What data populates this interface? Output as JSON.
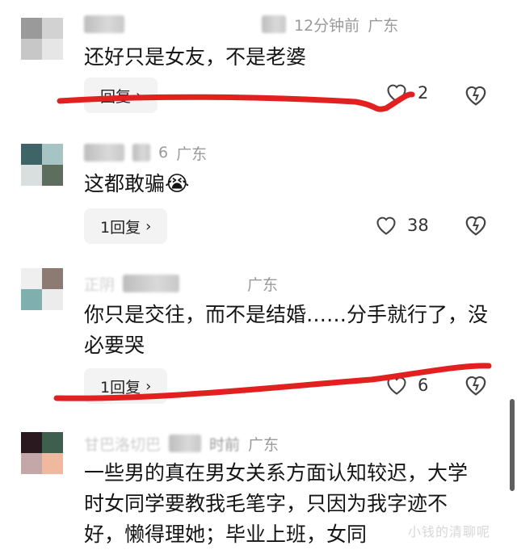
{
  "comments": [
    {
      "time": "12分钟前",
      "region": "广东",
      "text": "还好只是女友，不是老婆",
      "reply_label": "回复",
      "like_count": "2",
      "avatar_colors": [
        "#9a9a9a",
        "#d2d2d2",
        "#c7c7c7",
        "#e6e6e6"
      ]
    },
    {
      "time": "6",
      "region": "广东",
      "text": "这都敢骗",
      "emoji": "😭",
      "reply_label": "1回复",
      "like_count": "38",
      "avatar_colors": [
        "#3e6468",
        "#a6c4c4",
        "#d9dfde",
        "#5e6e5e"
      ]
    },
    {
      "username": "正阴",
      "region": "广东",
      "text": "你只是交往，而不是结婚……分手就行了，没必要哭",
      "reply_label": "1回复",
      "like_count": "6",
      "avatar_colors": [
        "#efefef",
        "#8b7b73",
        "#7fb0ae",
        "#ececec"
      ]
    },
    {
      "username": "甘巴洛切巴",
      "time": "时前",
      "region": "广东",
      "text": "一些男的真在男女关系方面认知较迟，大学时女同学要教我毛笔字，只因为我字迹不好，懒得理她；毕业上班，女同",
      "avatar_colors": [
        "#2a1a20",
        "#3e5e4e",
        "#c4a7a8",
        "#f1b8a0"
      ]
    }
  ],
  "watermark": "小钱的清聊呢",
  "annotation_color": "#e32020"
}
